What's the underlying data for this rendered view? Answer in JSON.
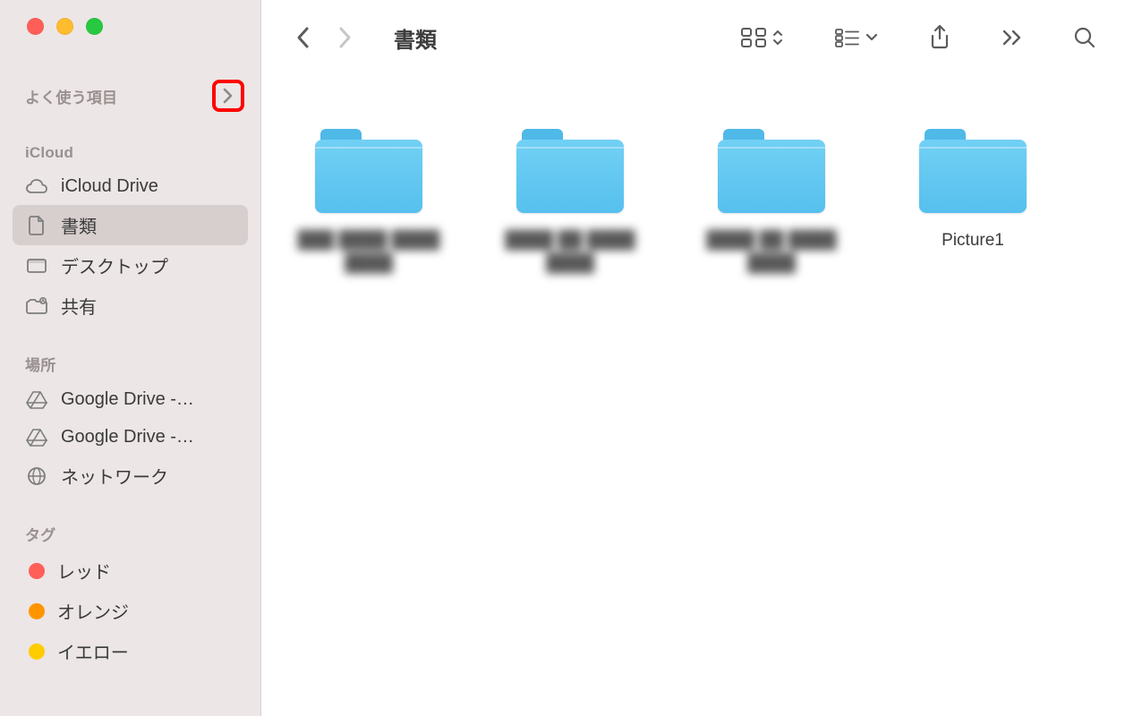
{
  "window": {
    "title": "書類"
  },
  "sidebar": {
    "sections": {
      "favorites": {
        "label": "よく使う項目"
      },
      "icloud": {
        "label": "iCloud",
        "items": [
          {
            "icon": "cloud-icon",
            "label": "iCloud Drive"
          },
          {
            "icon": "document-icon",
            "label": "書類"
          },
          {
            "icon": "desktop-icon",
            "label": "デスクトップ"
          },
          {
            "icon": "shared-icon",
            "label": "共有"
          }
        ]
      },
      "locations": {
        "label": "場所",
        "items": [
          {
            "icon": "gdrive-icon",
            "label": "Google Drive -…"
          },
          {
            "icon": "gdrive-icon",
            "label": "Google Drive -…"
          },
          {
            "icon": "network-icon",
            "label": "ネットワーク"
          }
        ]
      },
      "tags": {
        "label": "タグ",
        "items": [
          {
            "color": "#ff5f57",
            "label": "レッド"
          },
          {
            "color": "#ff9500",
            "label": "オレンジ"
          },
          {
            "color": "#ffcc00",
            "label": "イエロー"
          }
        ]
      }
    }
  },
  "files": [
    {
      "name": "███ ████ ████ ████",
      "blurred": true
    },
    {
      "name": "████ ██ ████ ████",
      "blurred": true
    },
    {
      "name": "████ ██ ████ ████",
      "blurred": true
    },
    {
      "name": "Picture1",
      "blurred": false
    }
  ]
}
